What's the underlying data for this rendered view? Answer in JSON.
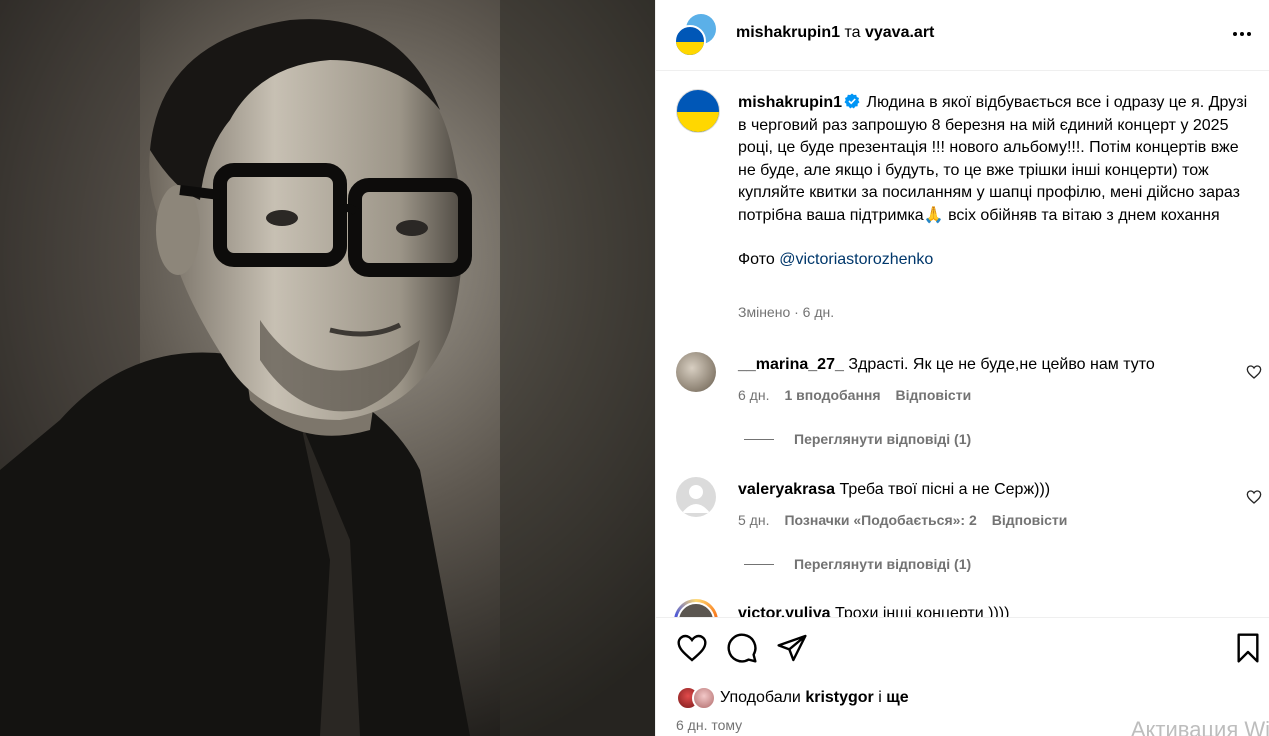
{
  "post": {
    "photo_alt": "post-photo"
  },
  "header": {
    "author": "mishakrupin1",
    "connector": "та",
    "coauthor": "vyava.art"
  },
  "caption": {
    "username": "mishakrupin1",
    "text": "Людина в якої відбувається все і одразу це я. Друзі в черговий раз запрошую 8 березня на мій єдиний концерт у 2025 році, це буде презентація !!! нового альбому!!!. Потім концертів вже не буде, але якщо і будуть, то це вже трішки інші концерти) тож купляйте квитки за посиланням у шапці профілю, мені дійсно зараз потрібна ваша підтримка🙏 всіх обійняв та вітаю з днем кохання",
    "photo_label": "Фото",
    "photo_credit": "@victoriastorozhenko",
    "edited": "Змінено · 6 дн."
  },
  "comments": [
    {
      "username": "__marina_27_",
      "text": "Здрасті. Як це не буде,не цейво нам туто",
      "time": "6 дн.",
      "likes": "1 вподобання",
      "reply": "Відповісти",
      "view_replies": "Переглянути відповіді (1)"
    },
    {
      "username": "valeryakrasa",
      "text": "Треба твої пісні а не Серж)))",
      "time": "5 дн.",
      "likes": "Позначки «Подобається»: 2",
      "reply": "Відповісти",
      "view_replies": "Переглянути відповіді (1)"
    },
    {
      "username": "victor.yuliya",
      "text": "Трохи інші концерти ))))"
    }
  ],
  "footer": {
    "liked_by_prefix": "Уподобали",
    "liked_by_user": "kristygor",
    "liked_by_suffix": "і",
    "liked_by_more": "ще",
    "time": "6 дн. тому",
    "watermark": "Активация Wi"
  },
  "icons": {
    "more": "more-horizontal-icon",
    "verified": "verified-badge-icon",
    "like": "heart-icon",
    "comment": "comment-icon",
    "share": "share-icon",
    "save": "bookmark-icon"
  },
  "colors": {
    "link": "#00376b",
    "secondary_text": "#737373",
    "verified": "#0095f6"
  }
}
